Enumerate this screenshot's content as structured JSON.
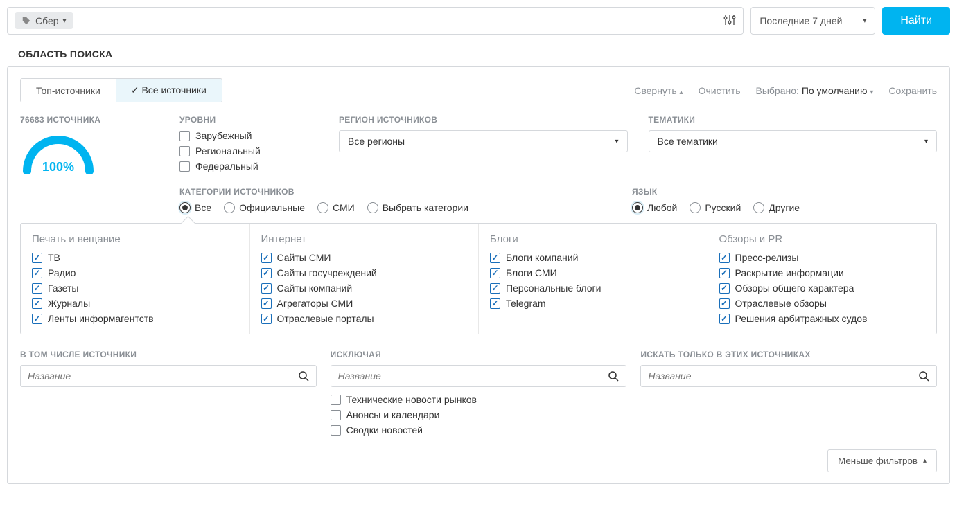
{
  "topbar": {
    "tag_label": "Сбер",
    "date_range": "Последние 7 дней",
    "search_button": "Найти"
  },
  "section_title": "ОБЛАСТЬ ПОИСКА",
  "panel_header": {
    "tab_top": "Топ-источники",
    "tab_all": "Все источники",
    "collapse": "Свернуть",
    "clear": "Очистить",
    "selected_prefix": "Выбрано:",
    "selected_value": "По умолчанию",
    "save": "Сохранить"
  },
  "gauge": {
    "label": "76683 ИСТОЧНИКА",
    "percent": "100%"
  },
  "levels": {
    "label": "УРОВНИ",
    "items": [
      "Зарубежный",
      "Региональный",
      "Федеральный"
    ]
  },
  "region": {
    "label": "РЕГИОН ИСТОЧНИКОВ",
    "value": "Все регионы"
  },
  "theme": {
    "label": "ТЕМАТИКИ",
    "value": "Все тематики"
  },
  "categories": {
    "label": "КАТЕГОРИИ ИСТОЧНИКОВ",
    "options": [
      "Все",
      "Официальные",
      "СМИ",
      "Выбрать категории"
    ]
  },
  "language": {
    "label": "ЯЗЫК",
    "options": [
      "Любой",
      "Русский",
      "Другие"
    ]
  },
  "cat_groups": [
    {
      "title": "Печать и вещание",
      "items": [
        "ТВ",
        "Радио",
        "Газеты",
        "Журналы",
        "Ленты информагентств"
      ]
    },
    {
      "title": "Интернет",
      "items": [
        "Сайты СМИ",
        "Сайты госучреждений",
        "Сайты компаний",
        "Агрегаторы СМИ",
        "Отраслевые порталы"
      ]
    },
    {
      "title": "Блоги",
      "items": [
        "Блоги компаний",
        "Блоги СМИ",
        "Персональные блоги",
        "Telegram"
      ]
    },
    {
      "title": "Обзоры и PR",
      "items": [
        "Пресс-релизы",
        "Раскрытие информации",
        "Обзоры общего характера",
        "Отраслевые обзоры",
        "Решения арбитражных судов"
      ]
    }
  ],
  "include": {
    "label": "В ТОМ ЧИСЛЕ ИСТОЧНИКИ",
    "placeholder": "Название"
  },
  "exclude": {
    "label": "ИСКЛЮЧАЯ",
    "placeholder": "Название",
    "items": [
      "Технические новости рынков",
      "Анонсы и календари",
      "Сводки новостей"
    ]
  },
  "only": {
    "label": "ИСКАТЬ ТОЛЬКО В ЭТИХ ИСТОЧНИКАХ",
    "placeholder": "Название"
  },
  "footer": {
    "less_filters": "Меньше фильтров"
  }
}
